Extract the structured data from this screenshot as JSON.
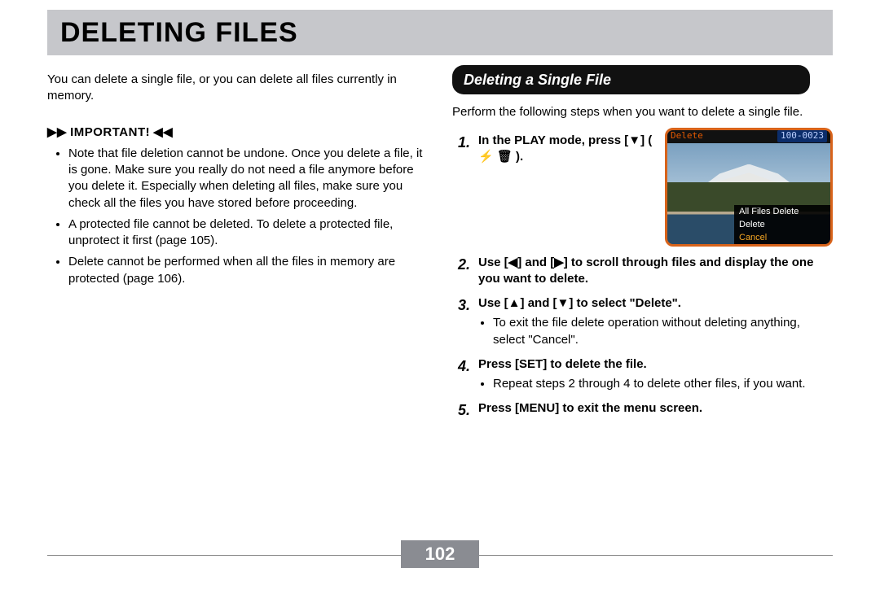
{
  "title": "DELETING FILES",
  "intro": "You can delete a single file, or you can delete all files currently in memory.",
  "important_label": "IMPORTANT!",
  "important_items": [
    "Note that file deletion cannot be undone. Once you delete a file, it is gone. Make sure you really do not need a file anymore before you delete it. Especially when deleting all files, make sure you check all the files you have stored before proceeding.",
    "A protected file cannot be deleted. To delete a protected file, unprotect it first (page 105).",
    "Delete cannot be performed when all the files in memory are protected (page 106)."
  ],
  "section_heading": "Deleting a Single File",
  "section_intro": "Perform the following steps when you want to delete a single file.",
  "steps": [
    {
      "num": "1.",
      "title": "In the PLAY mode, press [▼] ( ⚡ 🗑 )."
    },
    {
      "num": "2.",
      "title": "Use [◀] and [▶] to scroll through files and display the one you want to delete."
    },
    {
      "num": "3.",
      "title": "Use [▲] and [▼] to select \"Delete\".",
      "sub": [
        "To exit the file delete operation without deleting anything, select \"Cancel\"."
      ]
    },
    {
      "num": "4.",
      "title": "Press [SET] to delete the file.",
      "sub": [
        "Repeat steps 2 through 4 to delete other files, if you want."
      ]
    },
    {
      "num": "5.",
      "title": "Press [MENU] to exit the menu screen."
    }
  ],
  "screenshot": {
    "top_label": "Delete",
    "counter": "100-0023",
    "menu": {
      "all": "All Files Delete",
      "del": "Delete",
      "cancel": "Cancel"
    }
  },
  "page_number": "102"
}
